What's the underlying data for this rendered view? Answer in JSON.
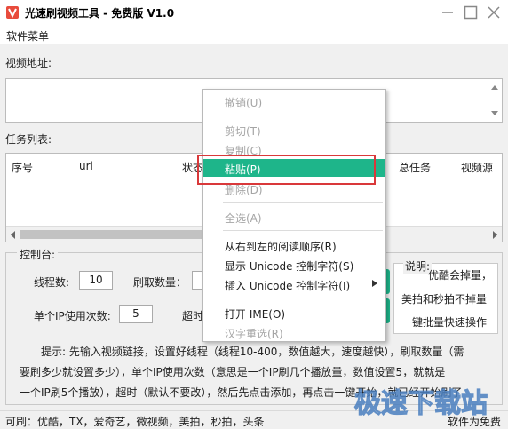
{
  "window": {
    "title": "光速刷视频工具 - 免费版 V1.0"
  },
  "menu": {
    "software_menu": "软件菜单"
  },
  "video_url": {
    "label": "视频地址:",
    "value": ""
  },
  "task_list": {
    "label": "任务列表:",
    "columns": [
      "序号",
      "url",
      "状态",
      "总任务",
      "视频源"
    ]
  },
  "console": {
    "legend": "控制台:",
    "threads_label": "线程数:",
    "threads_value": "10",
    "count_label": "刷取数量：",
    "per_ip_label": "单个IP使用次数:",
    "per_ip_value": "5",
    "timeout_label": "超时",
    "hint_lines": [
      "提示: 先输入视频链接，设置好线程（线程10-400，数值越大，速度越快），刷取数量（需",
      "要刷多少就设置多少），单个IP使用次数（意思是一个IP刷几个播放量，数值设置5，就就是",
      "一个IP刷5个播放），超时（默认不要改），然后先点击添加，再点击一键开始，就已经开始刷了"
    ]
  },
  "description": {
    "legend": "说明:",
    "lines": [
      "优酷会掉量，",
      "美拍和秒拍不掉量",
      "一键批量快速操作"
    ]
  },
  "status": {
    "left": "可刷：优酷，TX，爱奇艺，微视频，美拍，秒拍，头条",
    "right": "软件为免费"
  },
  "watermark": {
    "text": "极速下载站"
  },
  "context_menu": {
    "items": [
      {
        "label": "撤销(U)",
        "disabled": true
      },
      {
        "label": "剪切(T)",
        "disabled": true
      },
      {
        "label": "复制(C)",
        "disabled": true
      },
      {
        "label": "粘贴(P)",
        "disabled": false,
        "active": true
      },
      {
        "label": "删除(D)",
        "disabled": true
      },
      {
        "label": "全选(A)",
        "disabled": true
      },
      {
        "label": "从右到左的阅读顺序(R)",
        "disabled": false
      },
      {
        "label": "显示 Unicode 控制字符(S)",
        "disabled": false
      },
      {
        "label": "插入 Unicode 控制字符(I)",
        "disabled": false,
        "submenu": true
      },
      {
        "label": "打开 IME(O)",
        "disabled": false
      },
      {
        "label": "汉字重选(R)",
        "disabled": true
      }
    ]
  },
  "colors": {
    "accent": "#1eb58a",
    "highlight_border": "#d9383a",
    "disabled_text": "#a5a5a5"
  },
  "icons": {
    "app": "app-logo-icon",
    "minimize": "minimize-icon",
    "maximize": "maximize-icon",
    "close": "close-icon",
    "submenu": "chevron-right-icon"
  }
}
